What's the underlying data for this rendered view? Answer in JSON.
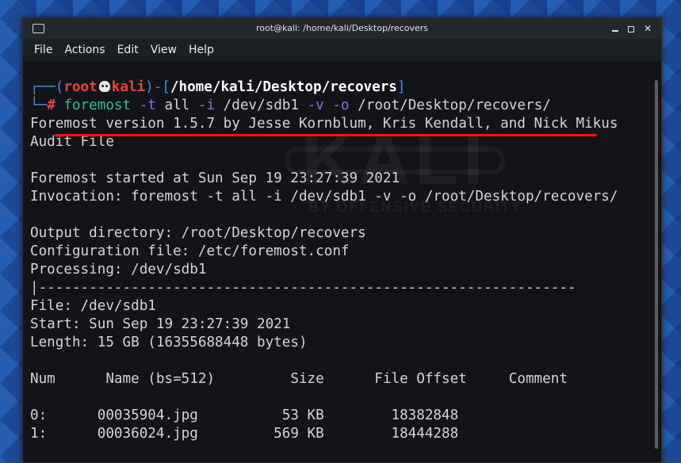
{
  "window": {
    "title": "root@kali: /home/kali/Desktop/recovers"
  },
  "menu": {
    "items": [
      "File",
      "Actions",
      "Edit",
      "View",
      "Help"
    ]
  },
  "watermark": {
    "logo": "KALI",
    "tagline": "BY OFFENSIVE SECURITY"
  },
  "prompt": {
    "user": "root",
    "host": "kali",
    "path": "/home/kali/Desktop/recovers",
    "symbol": "#",
    "cmd": "foremost",
    "opt_t": "-t",
    "arg_t": "all",
    "opt_i": "-i",
    "arg_i": "/dev/sdb1",
    "opt_v": "-v",
    "opt_o": "-o",
    "arg_o": "/root/Desktop/recovers/"
  },
  "output": {
    "lines": [
      "Foremost version 1.5.7 by Jesse Kornblum, Kris Kendall, and Nick Mikus",
      "Audit File",
      "",
      "Foremost started at Sun Sep 19 23:27:39 2021",
      "Invocation: foremost -t all -i /dev/sdb1 -v -o /root/Desktop/recovers/",
      "",
      "Output directory: /root/Desktop/recovers",
      "Configuration file: /etc/foremost.conf",
      "Processing: /dev/sdb1",
      "|----------------------------------------------------------------",
      "File: /dev/sdb1",
      "Start: Sun Sep 19 23:27:39 2021",
      "Length: 15 GB (16355688448 bytes)",
      "",
      "Num      Name (bs=512)         Size      File Offset     Comment",
      "",
      "0:      00035904.jpg          53 KB        18382848",
      "1:      00036024.jpg         569 KB        18444288"
    ]
  }
}
